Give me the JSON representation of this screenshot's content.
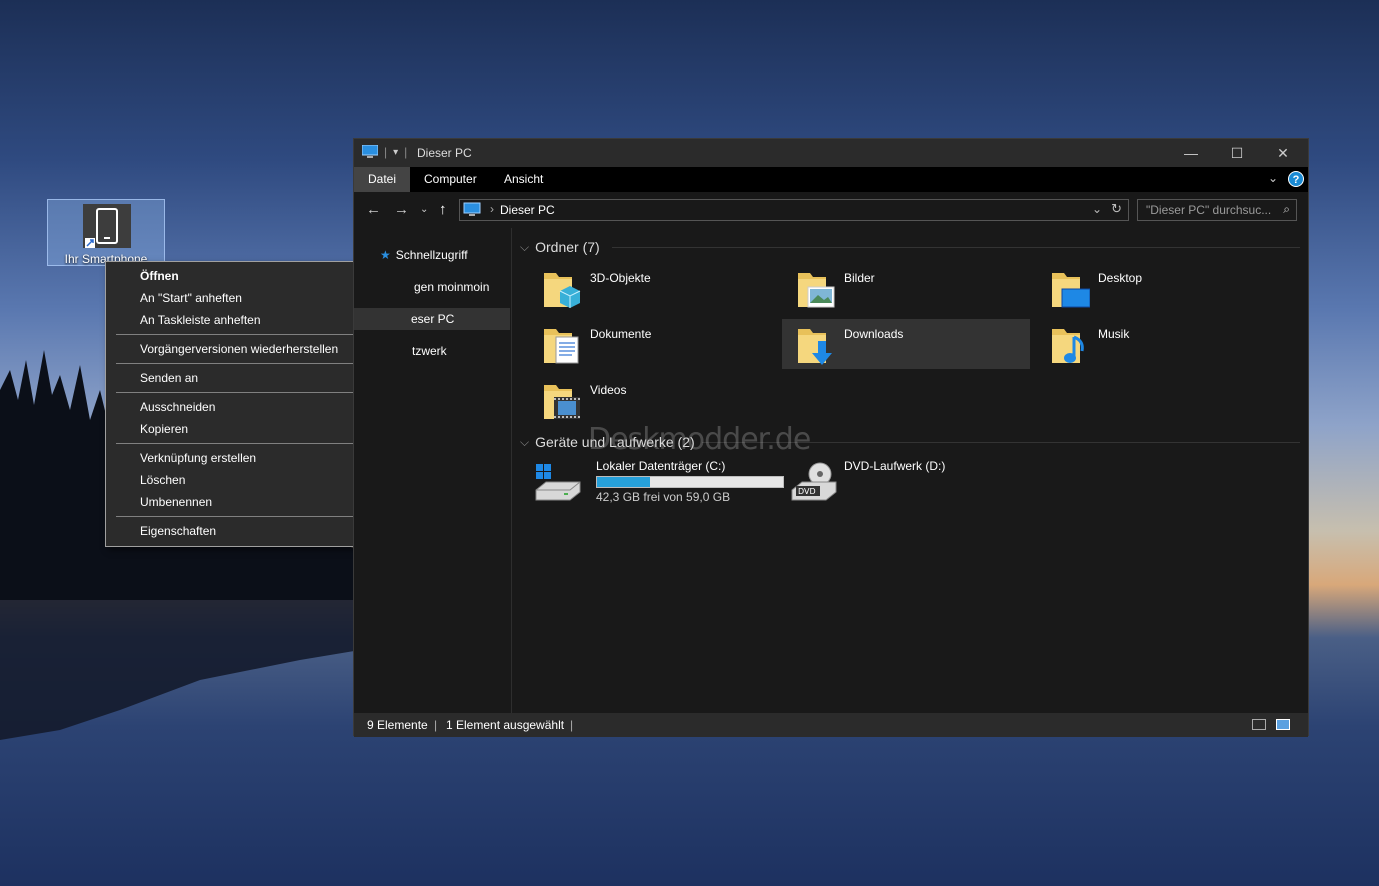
{
  "desktop": {
    "icon_label": "Ihr Smartphone"
  },
  "context_menu": {
    "items": [
      {
        "label": "Öffnen"
      },
      {
        "label": "An \"Start\" anheften"
      },
      {
        "label": "An Taskleiste anheften"
      },
      {
        "label": "Vorgängerversionen wiederherstellen"
      },
      {
        "label": "Senden an"
      },
      {
        "label": "Ausschneiden"
      },
      {
        "label": "Kopieren"
      },
      {
        "label": "Verknüpfung erstellen"
      },
      {
        "label": "Löschen"
      },
      {
        "label": "Umbenennen"
      },
      {
        "label": "Eigenschaften"
      }
    ]
  },
  "window": {
    "title": "Dieser PC",
    "tabs": [
      "Datei",
      "Computer",
      "Ansicht"
    ],
    "address": "Dieser PC",
    "search_placeholder": "\"Dieser PC\" durchsuc...",
    "nav": [
      {
        "label": "Schnellzugriff"
      },
      {
        "label": "gen moinmoin"
      },
      {
        "label": "eser PC"
      },
      {
        "label": "tzwerk"
      }
    ],
    "folders_header": "Ordner (7)",
    "folders": [
      {
        "name": "3D-Objekte",
        "icon": "3d-objects-folder-icon"
      },
      {
        "name": "Bilder",
        "icon": "pictures-folder-icon"
      },
      {
        "name": "Desktop",
        "icon": "desktop-folder-icon"
      },
      {
        "name": "Dokumente",
        "icon": "documents-folder-icon"
      },
      {
        "name": "Downloads",
        "icon": "downloads-folder-icon"
      },
      {
        "name": "Musik",
        "icon": "music-folder-icon"
      },
      {
        "name": "Videos",
        "icon": "videos-folder-icon"
      }
    ],
    "drives_header": "Geräte und Laufwerke (2)",
    "drives": [
      {
        "name": "Lokaler Datenträger (C:)",
        "free": "42,3 GB frei von 59,0 GB",
        "used_fraction": 0.283
      },
      {
        "name": "DVD-Laufwerk (D:)"
      }
    ],
    "status": {
      "count": "9 Elemente",
      "selected": "1 Element ausgewählt"
    }
  },
  "watermark": "Deskmodder.de"
}
